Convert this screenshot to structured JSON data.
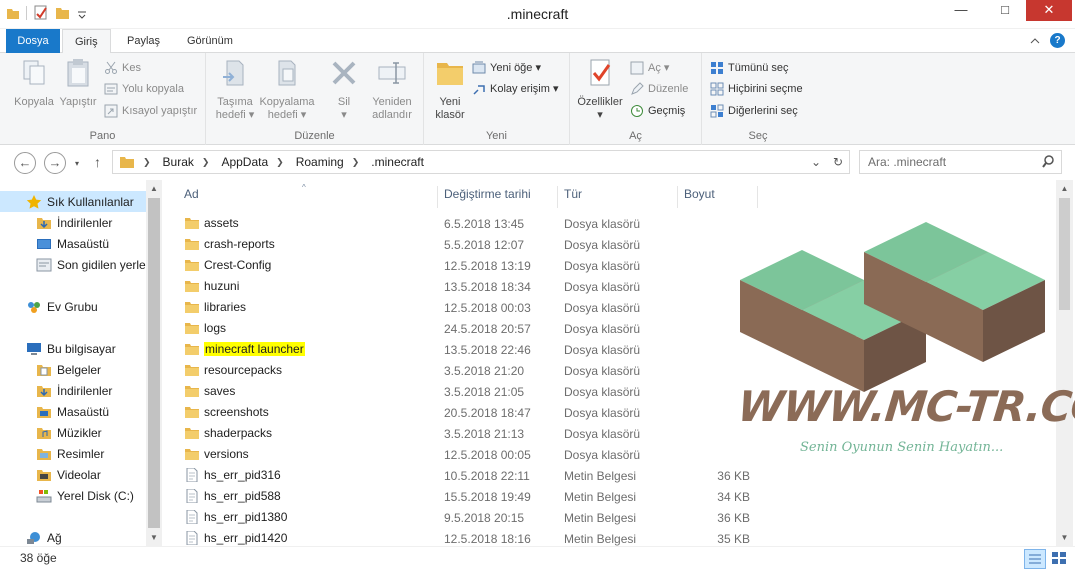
{
  "window": {
    "title": ".minecraft",
    "minimize": "—",
    "maximize": "□",
    "close": "✕"
  },
  "tabs": {
    "dosya": "Dosya",
    "giris": "Giriş",
    "paylas": "Paylaş",
    "gorunum": "Görünüm"
  },
  "ribbon": {
    "pano": {
      "label": "Pano",
      "kopyala": "Kopyala",
      "yapistir": "Yapıştır",
      "kes": "Kes",
      "yolu_kopyala": "Yolu kopyala",
      "kisayol_yapistir": "Kısayol yapıştır"
    },
    "duzenle": {
      "label": "Düzenle",
      "tasima_hedefi_1": "Taşıma",
      "tasima_hedefi_2": "hedefi ▾",
      "kopyalama_hedefi_1": "Kopyalama",
      "kopyalama_hedefi_2": "hedefi ▾",
      "sil": "Sil",
      "sil_arrow": "▾",
      "yeniden_adlandir_1": "Yeniden",
      "yeniden_adlandir_2": "adlandır"
    },
    "yeni": {
      "label": "Yeni",
      "yeni_klasor_1": "Yeni",
      "yeni_klasor_2": "klasör",
      "yeni_oge": "Yeni öğe ▾",
      "kolay_erisim": "Kolay erişim ▾"
    },
    "ac": {
      "label": "Aç",
      "ozellikler": "Özellikler",
      "ozellikler_arrow": "▾",
      "ac_btn": "Aç ▾",
      "duzenle_btn": "Düzenle",
      "gecmis": "Geçmiş"
    },
    "sec": {
      "label": "Seç",
      "tumunu_sec": "Tümünü seç",
      "hicbirini_secme": "Hiçbirini seçme",
      "digerlerini_sec": "Diğerlerini seç"
    }
  },
  "address": {
    "crumbs": [
      "Burak",
      "AppData",
      "Roaming",
      ".minecraft"
    ],
    "search_placeholder": "Ara: .minecraft"
  },
  "navpane": {
    "items": [
      "Sık Kullanılanlar",
      "İndirilenler",
      "Masaüstü",
      "Son gidilen yerler",
      "Ev Grubu",
      "Bu bilgisayar",
      "Belgeler",
      "İndirilenler",
      "Masaüstü",
      "Müzikler",
      "Resimler",
      "Videolar",
      "Yerel Disk (C:)",
      "Ağ"
    ]
  },
  "columns": {
    "name": "Ad",
    "date": "Değiştirme tarihi",
    "type": "Tür",
    "size": "Boyut"
  },
  "files": [
    {
      "name": "assets",
      "date": "6.5.2018 13:45",
      "type": "Dosya klasörü",
      "size": ""
    },
    {
      "name": "crash-reports",
      "date": "5.5.2018 12:07",
      "type": "Dosya klasörü",
      "size": ""
    },
    {
      "name": "Crest-Config",
      "date": "12.5.2018 13:19",
      "type": "Dosya klasörü",
      "size": ""
    },
    {
      "name": "huzuni",
      "date": "13.5.2018 18:34",
      "type": "Dosya klasörü",
      "size": ""
    },
    {
      "name": "libraries",
      "date": "12.5.2018 00:03",
      "type": "Dosya klasörü",
      "size": ""
    },
    {
      "name": "logs",
      "date": "24.5.2018 20:57",
      "type": "Dosya klasörü",
      "size": ""
    },
    {
      "name": "minecraft launcher",
      "date": "13.5.2018 22:46",
      "type": "Dosya klasörü",
      "size": ""
    },
    {
      "name": "resourcepacks",
      "date": "3.5.2018 21:20",
      "type": "Dosya klasörü",
      "size": ""
    },
    {
      "name": "saves",
      "date": "3.5.2018 21:05",
      "type": "Dosya klasörü",
      "size": ""
    },
    {
      "name": "screenshots",
      "date": "20.5.2018 18:47",
      "type": "Dosya klasörü",
      "size": ""
    },
    {
      "name": "shaderpacks",
      "date": "3.5.2018 21:13",
      "type": "Dosya klasörü",
      "size": ""
    },
    {
      "name": "versions",
      "date": "12.5.2018 00:05",
      "type": "Dosya klasörü",
      "size": ""
    },
    {
      "name": "hs_err_pid316",
      "date": "10.5.2018 22:11",
      "type": "Metin Belgesi",
      "size": "36 KB"
    },
    {
      "name": "hs_err_pid588",
      "date": "15.5.2018 19:49",
      "type": "Metin Belgesi",
      "size": "34 KB"
    },
    {
      "name": "hs_err_pid1380",
      "date": "9.5.2018 20:15",
      "type": "Metin Belgesi",
      "size": "36 KB"
    },
    {
      "name": "hs_err_pid1420",
      "date": "12.5.2018 18:16",
      "type": "Metin Belgesi",
      "size": "35 KB"
    }
  ],
  "watermark": {
    "site": "WWW.MC-TR.COM",
    "slogan": "Senin Oyunun Senin Hayatın..."
  },
  "status": {
    "count": "38 öğe"
  },
  "colors": {
    "accent": "#1979ca",
    "selected": "#cce8ff",
    "highlight": "#ffff00",
    "folder": "#e8b64b",
    "grass": "#7cc59a",
    "dirt": "#8b6b57"
  },
  "icons": {
    "folder": "folder-icon",
    "text_file": "text-file-icon",
    "star": "star-icon",
    "homegroup": "homegroup-icon",
    "computer": "computer-icon",
    "network": "network-icon"
  }
}
